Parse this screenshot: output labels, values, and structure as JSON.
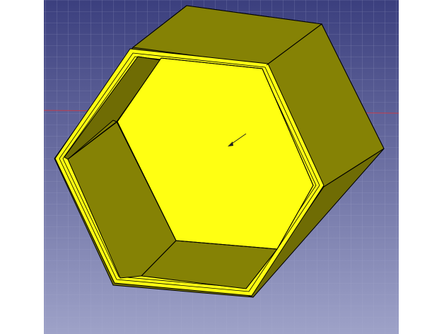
{
  "viewport": {
    "background_top": "#3b3f7e",
    "background_bottom": "#9ea2c8",
    "grid_color": "#aeb1d3",
    "axis_color": "#c23b4a"
  },
  "model": {
    "face_color": "#ffff12",
    "side_color": "#858205",
    "side_color_dark": "#6f6c04",
    "edge_color": "#000000"
  },
  "icons": {
    "cursor": "arrow-cursor"
  }
}
